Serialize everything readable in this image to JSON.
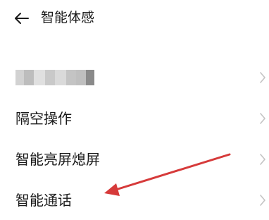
{
  "header": {
    "back_icon": "arrow-left-icon",
    "title": "智能体感"
  },
  "menu": {
    "items": [
      {
        "label": "",
        "blurred": true,
        "chevron_icon": "chevron-right-icon"
      },
      {
        "label": "隔空操作",
        "chevron_icon": "chevron-right-icon"
      },
      {
        "label": "智能亮屏熄屏",
        "chevron_icon": "chevron-right-icon"
      },
      {
        "label": "智能通话",
        "chevron_icon": "chevron-right-icon"
      }
    ]
  },
  "annotation": {
    "arrow_icon": "red-annotation-arrow-icon",
    "arrow_color": "#d63a3a"
  },
  "colors": {
    "background": "#ffffff",
    "text": "#1a1a1a",
    "chevron": "#c4c4c4"
  }
}
